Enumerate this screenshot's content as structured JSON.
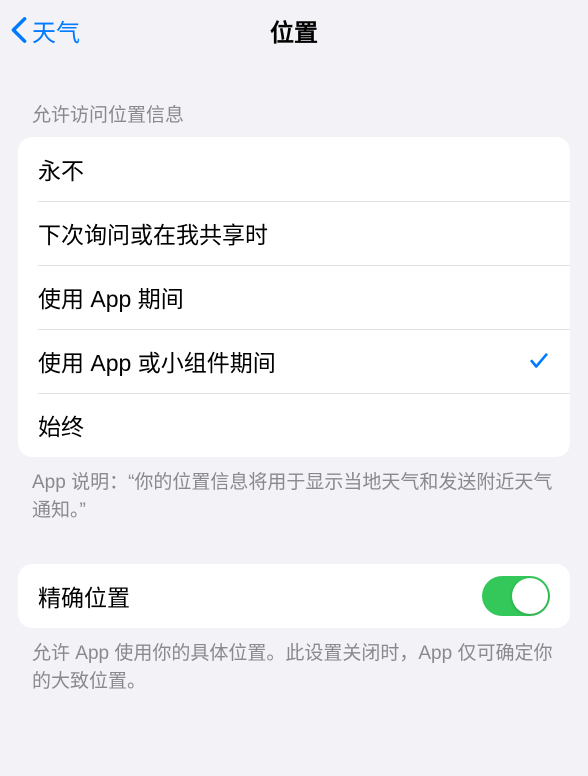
{
  "navbar": {
    "back_label": "天气",
    "title": "位置"
  },
  "section1": {
    "header": "允许访问位置信息",
    "options": [
      {
        "label": "永不",
        "selected": false
      },
      {
        "label": "下次询问或在我共享时",
        "selected": false
      },
      {
        "label": "使用 App 期间",
        "selected": false
      },
      {
        "label": "使用 App 或小组件期间",
        "selected": true
      },
      {
        "label": "始终",
        "selected": false
      }
    ],
    "footer": "App 说明：“你的位置信息将用于显示当地天气和发送附近天气通知。”"
  },
  "section2": {
    "row": {
      "label": "精确位置",
      "enabled": true
    },
    "footer": "允许 App 使用你的具体位置。此设置关闭时，App 仅可确定你的大致位置。"
  }
}
